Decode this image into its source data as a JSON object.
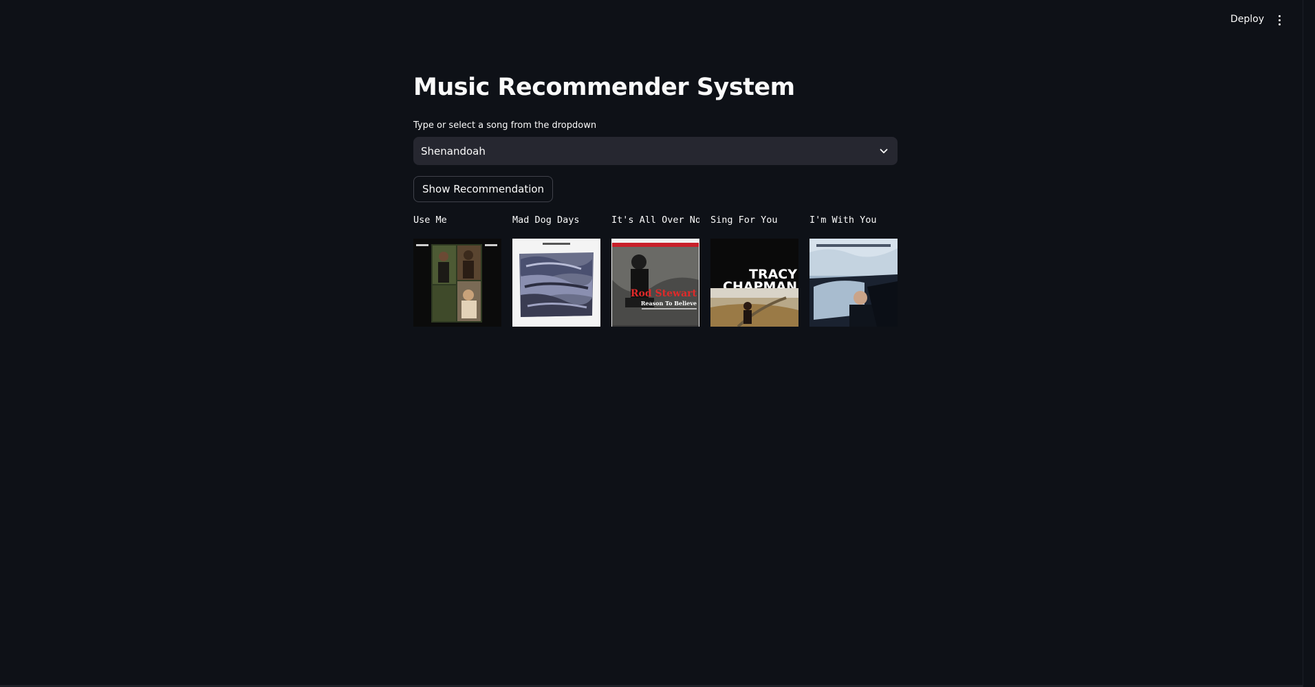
{
  "header": {
    "deploy_label": "Deploy",
    "menu_icon": "more-vertical-icon"
  },
  "page": {
    "title": "Music Recommender System",
    "select_label": "Type or select a song from the dropdown",
    "selected_song": "Shenandoah",
    "button_label": "Show Recommendation"
  },
  "recommendations": [
    {
      "title": "Use Me",
      "cover_icon": "album-cover-image"
    },
    {
      "title": "Mad Dog Days",
      "cover_icon": "album-cover-image"
    },
    {
      "title": "It's All Over Now",
      "cover_icon": "album-cover-image",
      "cover_text": [
        "Rod Stewart",
        "Reason To Believe"
      ]
    },
    {
      "title": "Sing For You",
      "cover_icon": "album-cover-image",
      "cover_text": [
        "TRACY",
        "CHAPMAN"
      ]
    },
    {
      "title": "I'm With You",
      "cover_icon": "album-cover-image"
    }
  ],
  "colors": {
    "background": "#0e1117",
    "select_bg": "#262730",
    "button_border": "#40424b",
    "text": "#fafafa"
  }
}
